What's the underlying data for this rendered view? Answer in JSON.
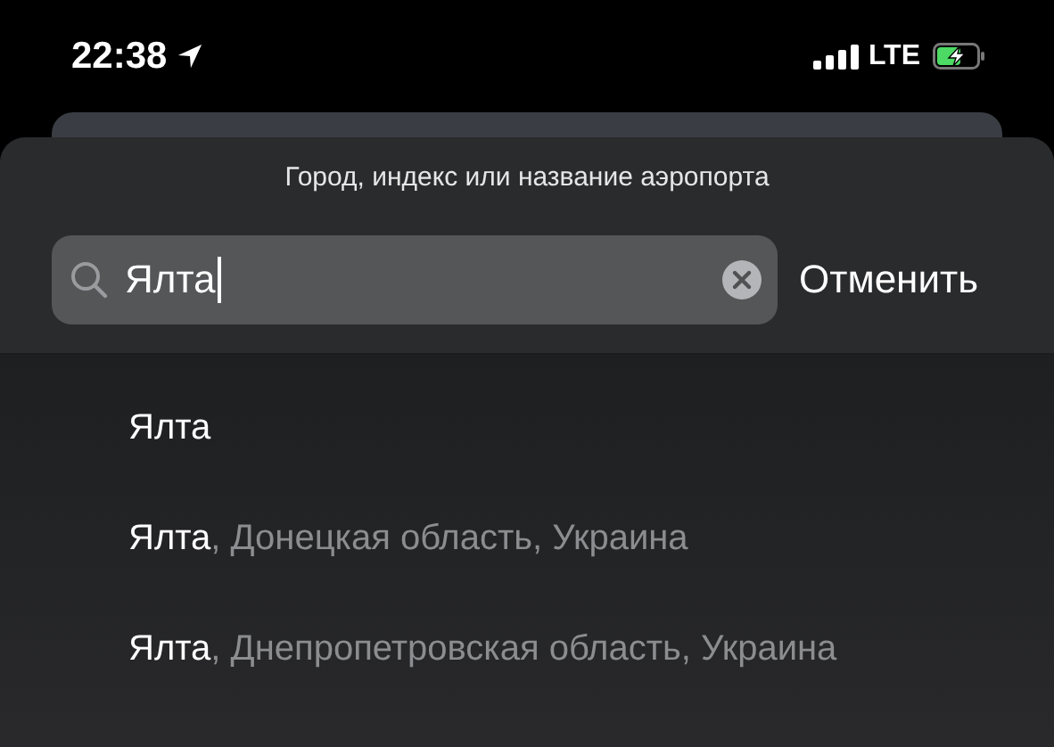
{
  "status_bar": {
    "time": "22:38",
    "network": "LTE"
  },
  "search": {
    "prompt": "Город, индекс или название аэропорта",
    "value": "Ялта",
    "cancel": "Отменить"
  },
  "results": [
    {
      "match": "Ялта"
    },
    {
      "match": "Ялта",
      "rest": ", Донецкая область, Украина"
    },
    {
      "match": "Ялта",
      "rest": ", Днепропетровская область, Украина"
    }
  ]
}
